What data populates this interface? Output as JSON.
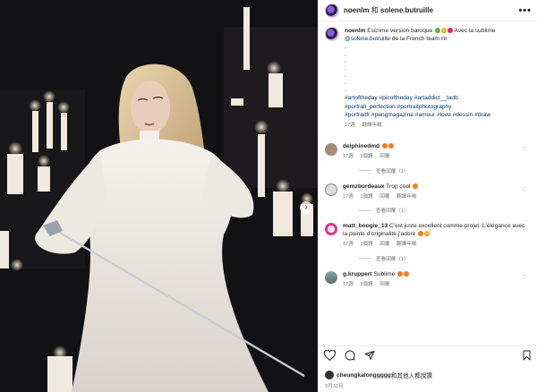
{
  "post": {
    "author": "noenlm",
    "joiner": "和",
    "coauthor": "solene.butruille"
  },
  "caption": {
    "username": "noenlm",
    "text_1": "Escrime version baroque",
    "text_2": "Avec la sublime",
    "mention": "@solene.butruille",
    "text_3": "de la French team",
    "flag": "FR",
    "dots": [
      ".",
      ".",
      ".",
      ".",
      ".",
      ".",
      "."
    ],
    "hashtags_line1": "#artoftheday #picoftheday #artaddict__tadb",
    "hashtags_line2": "#portrait_perfection #portraitphotography",
    "hashtags_line3": "#portraitfr #pengmagazine #amour #love #dessin #draw",
    "time": "17週",
    "translate": "翻譯年糕"
  },
  "comments": [
    {
      "username": "delphinedmd",
      "text": "",
      "time": "17週",
      "likes": "1個讚",
      "reply": "回覆",
      "translate": "",
      "view_replies": "查看回覆（1）"
    },
    {
      "username": "gemzbordeaux",
      "text": "Trop cool",
      "time": "17週",
      "likes": "1個讚",
      "reply": "回覆",
      "translate": "翻譯年糕",
      "view_replies": "查看回覆（1）"
    },
    {
      "username": "matt_boogie_13",
      "text": "C'est juste excellent comme projet. L'élégance avec la pointe d'originalité j'adore",
      "time": "17週",
      "likes": "1個讚",
      "reply": "回覆",
      "translate": "翻譯年糕",
      "view_replies": "查看回覆（1）"
    },
    {
      "username": "g.kruppert",
      "text": "Sublime",
      "time": "17週",
      "likes": "1個讚",
      "reply": "回覆",
      "translate": "",
      "view_replies": ""
    }
  ],
  "likes_line": {
    "username": "cheungkalonggggg",
    "rest": "和其他人都說讚"
  },
  "date": "3月31日",
  "more_label": "•••",
  "carousel_next": "›",
  "icons": [
    "heart-icon",
    "comment-icon",
    "share-icon",
    "bookmark-icon"
  ]
}
